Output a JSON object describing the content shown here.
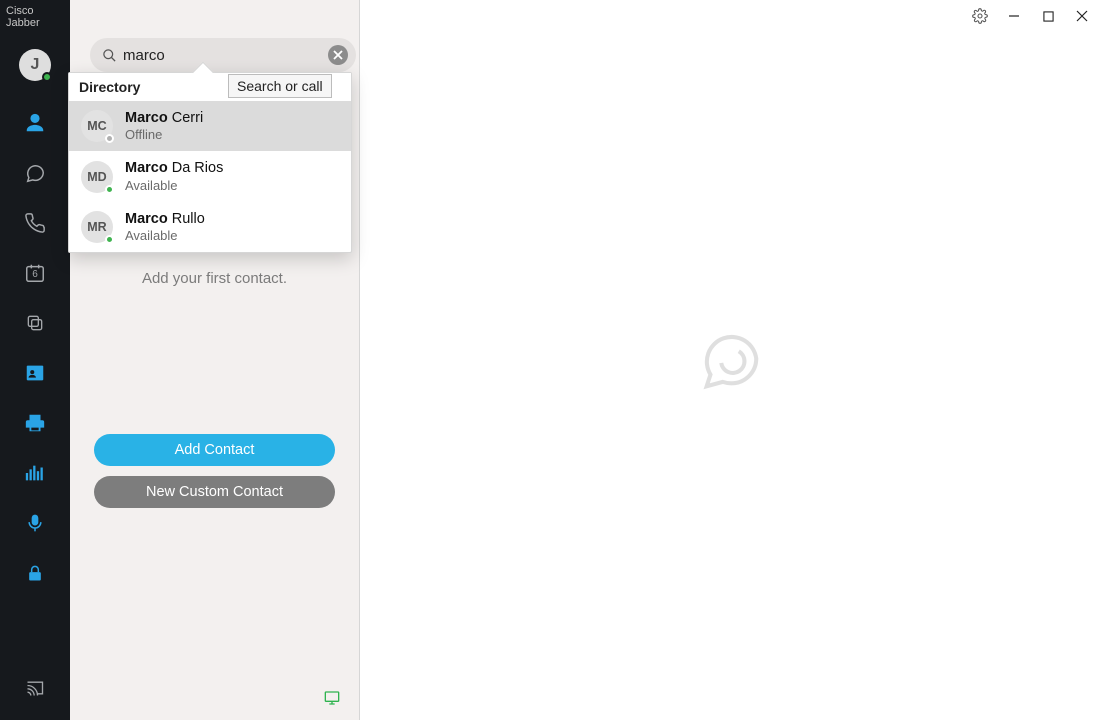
{
  "app_title": "Cisco Jabber",
  "avatar_letter": "J",
  "calendar_badge": "6",
  "search": {
    "value": "marco",
    "placeholder": "Search or call",
    "tooltip": "Search or call"
  },
  "dropdown": {
    "header": "Directory",
    "results": [
      {
        "initials": "MC",
        "match": "Marco",
        "rest": " Cerri",
        "status": "Offline",
        "presence": "offline",
        "highlight": true
      },
      {
        "initials": "MD",
        "match": "Marco",
        "rest": " Da Rios",
        "status": "Available",
        "presence": "online",
        "highlight": false
      },
      {
        "initials": "MR",
        "match": "Marco",
        "rest": " Rullo",
        "status": "Available",
        "presence": "online",
        "highlight": false
      }
    ]
  },
  "empty_state": {
    "hint": "Add your first contact."
  },
  "buttons": {
    "add_contact": "Add Contact",
    "new_custom": "New Custom Contact"
  }
}
